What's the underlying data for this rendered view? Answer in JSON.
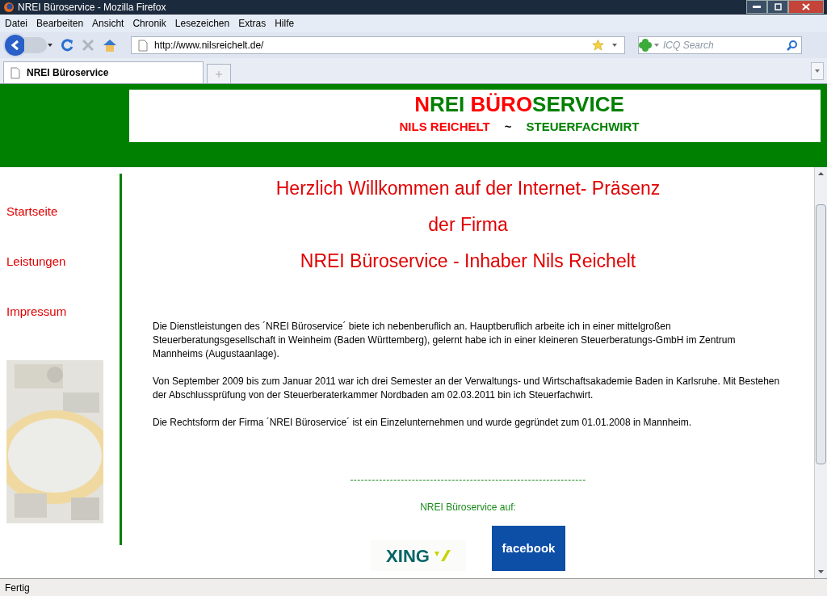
{
  "window": {
    "title": "NREI Büroservice - Mozilla Firefox"
  },
  "menu": [
    "Datei",
    "Bearbeiten",
    "Ansicht",
    "Chronik",
    "Lesezeichen",
    "Extras",
    "Hilfe"
  ],
  "address": {
    "value": "http://www.nilsreichelt.de/"
  },
  "search": {
    "placeholder": "ICQ Search"
  },
  "tabs": [
    {
      "label": "NREI Büroservice",
      "selected": true
    }
  ],
  "header": {
    "title": [
      {
        "text": "N",
        "color": "#ff0000"
      },
      {
        "text": "REI ",
        "color": "#008000"
      },
      {
        "text": "BÜRO",
        "color": "#ff0000"
      },
      {
        "text": "SERVICE",
        "color": "#008000"
      }
    ],
    "subtitle": [
      {
        "text": "NILS REICHELT",
        "color": "#ff0000"
      },
      {
        "text": "~",
        "color": "#000000"
      },
      {
        "text": "STEUERFACHWIRT",
        "color": "#008000"
      }
    ]
  },
  "nav": [
    "Startseite",
    "Leistungen",
    "Impressum"
  ],
  "side_image": {
    "kind": "picture"
  },
  "headings": [
    "Herzlich Willkommen auf der Internet- Präsenz",
    "der Firma",
    "NREI Büroservice - Inhaber Nils Reichelt"
  ],
  "paragraphs": [
    "Die Dienstleistungen des ´NREI Büroservice´ biete ich nebenberuflich an. Hauptberuflich arbeite ich in einer mittelgroßen Steuerberatungsgesellschaft in Weinheim (Baden Württemberg), gelernt habe ich in einer kleineren Steuerberatungs-GmbH im Zentrum Mannheims (Augustaanlage).",
    "Von September 2009 bis zum Januar 2011 war ich drei Semester an der Verwaltungs- und Wirtschaftsakademie Baden in Karlsruhe. Mit Bestehen der Abschlussprüfung von der Steuerberaterkammer Nordbaden am 02.03.2011 bin ich Steuerfachwirt.",
    "Die Rechtsform der Firma ´NREI Büroservice´ ist ein Einzelunternehmen und wurde gegründet zum 01.01.2008 in Mannheim."
  ],
  "separator": "-----------------------------------------------------------------",
  "social_label": "NREI Büroservice auf:",
  "social": [
    {
      "kind": "xing",
      "label": "XING"
    },
    {
      "kind": "facebook",
      "label": "facebook"
    }
  ],
  "status_bar": "Fertig"
}
